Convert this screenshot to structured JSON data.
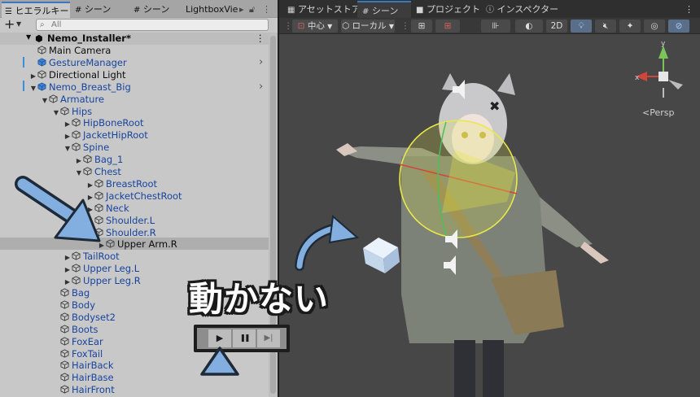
{
  "hierarchy": {
    "tabs": [
      {
        "label": "ヒエラルキー",
        "active": true
      },
      {
        "label": "シーン",
        "active": false
      },
      {
        "label": "シーン",
        "active": false
      },
      {
        "label": "LightboxVie",
        "active": false
      }
    ],
    "add_label": "+",
    "search_placeholder": "All",
    "scene_name": "Nemo_Installer*",
    "rows": [
      {
        "label": "Main Camera",
        "indent": 1,
        "arrow": "",
        "color": "black"
      },
      {
        "label": "GestureManager",
        "indent": 1,
        "arrow": "",
        "color": "blue",
        "chevron": true,
        "prefab": true
      },
      {
        "label": "Directional Light",
        "indent": 1,
        "arrow": "▶",
        "color": "black"
      },
      {
        "label": "Nemo_Breast_Big",
        "indent": 1,
        "arrow": "▼",
        "color": "blue",
        "chevron": true,
        "prefab": true
      },
      {
        "label": "Armature",
        "indent": 2,
        "arrow": "▼",
        "color": "blue"
      },
      {
        "label": "Hips",
        "indent": 3,
        "arrow": "▼",
        "color": "blue"
      },
      {
        "label": "HipBoneRoot",
        "indent": 4,
        "arrow": "▶",
        "color": "blue"
      },
      {
        "label": "JacketHipRoot",
        "indent": 4,
        "arrow": "▶",
        "color": "blue"
      },
      {
        "label": "Spine",
        "indent": 4,
        "arrow": "▼",
        "color": "blue"
      },
      {
        "label": "Bag_1",
        "indent": 5,
        "arrow": "▶",
        "color": "blue"
      },
      {
        "label": "Chest",
        "indent": 5,
        "arrow": "▼",
        "color": "blue"
      },
      {
        "label": "BreastRoot",
        "indent": 6,
        "arrow": "▶",
        "color": "blue"
      },
      {
        "label": "JacketChestRoot",
        "indent": 6,
        "arrow": "▶",
        "color": "blue"
      },
      {
        "label": "Neck",
        "indent": 6,
        "arrow": "▶",
        "color": "blue"
      },
      {
        "label": "Shoulder.L",
        "indent": 6,
        "arrow": "▶",
        "color": "blue"
      },
      {
        "label": "Shoulder.R",
        "indent": 6,
        "arrow": "▼",
        "color": "blue"
      },
      {
        "label": "Upper Arm.R",
        "indent": 7,
        "arrow": "▶",
        "color": "black",
        "selected": true
      },
      {
        "label": "TailRoot",
        "indent": 4,
        "arrow": "▶",
        "color": "blue"
      },
      {
        "label": "Upper Leg.L",
        "indent": 4,
        "arrow": "▶",
        "color": "blue"
      },
      {
        "label": "Upper Leg.R",
        "indent": 4,
        "arrow": "▶",
        "color": "blue"
      },
      {
        "label": "Bag",
        "indent": 3,
        "arrow": "",
        "color": "blue"
      },
      {
        "label": "Body",
        "indent": 3,
        "arrow": "",
        "color": "blue"
      },
      {
        "label": "Bodyset2",
        "indent": 3,
        "arrow": "",
        "color": "blue"
      },
      {
        "label": "Boots",
        "indent": 3,
        "arrow": "",
        "color": "blue"
      },
      {
        "label": "FoxEar",
        "indent": 3,
        "arrow": "",
        "color": "blue"
      },
      {
        "label": "FoxTail",
        "indent": 3,
        "arrow": "",
        "color": "blue"
      },
      {
        "label": "HairBack",
        "indent": 3,
        "arrow": "",
        "color": "blue"
      },
      {
        "label": "HairBase",
        "indent": 3,
        "arrow": "",
        "color": "blue"
      },
      {
        "label": "HairFront",
        "indent": 3,
        "arrow": "",
        "color": "blue"
      }
    ]
  },
  "scene_view": {
    "tabs": [
      {
        "label": "アセットストア",
        "active": false
      },
      {
        "label": "シーン",
        "active": true
      },
      {
        "label": "プロジェクト",
        "active": false
      },
      {
        "label": "インスペクター",
        "active": false
      }
    ],
    "toolbar": {
      "pivot_label": "中心",
      "space_label": "ローカル",
      "mode_2d": "2D"
    },
    "persp_label": "<Persp"
  },
  "annotation": {
    "caption": "動かない",
    "play_icon": "▶",
    "pause_icon": "❚❚",
    "step_icon": "▶|"
  },
  "colors": {
    "hier_bg": "#c8c8c8",
    "prefab_blue": "#17449e",
    "scene_bg": "#474747",
    "arrow_blue": "#82aee0",
    "gizmo_yellow": "#e8e84a"
  }
}
